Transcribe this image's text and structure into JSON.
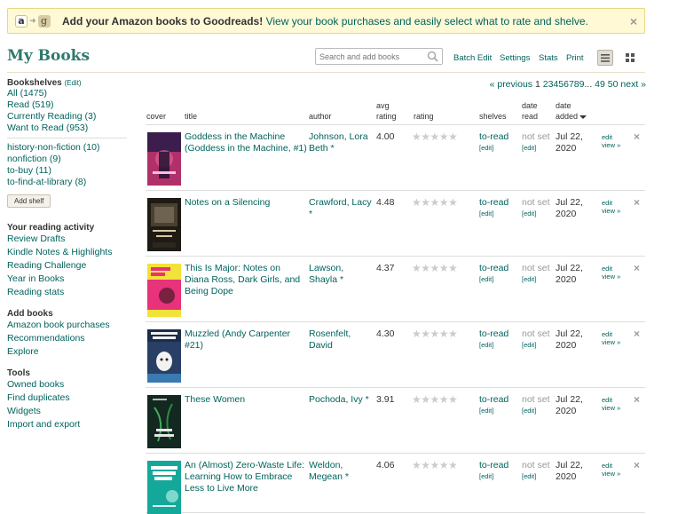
{
  "banner": {
    "bold_text": "Add your Amazon books to Goodreads!",
    "rest_text": " View your book purchases and easily select what to rate and shelve.",
    "logo_a": "a",
    "logo_g": "g",
    "close": "×"
  },
  "header": {
    "title": "My Books",
    "search_placeholder": "Search and add books",
    "links": {
      "batch_edit": "Batch Edit",
      "settings": "Settings",
      "stats": "Stats",
      "print": "Print"
    }
  },
  "sidebar": {
    "bookshelves_heading": "Bookshelves",
    "bookshelves_edit": "(Edit)",
    "shelves": [
      {
        "label": "All (1475)"
      },
      {
        "label": "Read (519)"
      },
      {
        "label": "Currently Reading (3)"
      },
      {
        "label": "Want to Read (953)"
      }
    ],
    "custom_shelves": [
      {
        "label": "history-non-fiction (10)"
      },
      {
        "label": "nonfiction (9)"
      },
      {
        "label": "to-buy (11)"
      },
      {
        "label": "to-find-at-library (8)"
      }
    ],
    "add_shelf": "Add shelf",
    "activity_heading": "Your reading activity",
    "activity": [
      {
        "label": "Review Drafts"
      },
      {
        "label": "Kindle Notes & Highlights"
      },
      {
        "label": "Reading Challenge"
      },
      {
        "label": "Year in Books"
      },
      {
        "label": "Reading stats"
      }
    ],
    "add_books_heading": "Add books",
    "add_books": [
      {
        "label": "Amazon book purchases"
      },
      {
        "label": "Recommendations"
      },
      {
        "label": "Explore"
      }
    ],
    "tools_heading": "Tools",
    "tools": [
      {
        "label": "Owned books"
      },
      {
        "label": "Find duplicates"
      },
      {
        "label": "Widgets"
      },
      {
        "label": "Import and export"
      }
    ]
  },
  "pagination": {
    "previous": "« previous",
    "current": "1",
    "pages": [
      "2",
      "3",
      "4",
      "5",
      "6",
      "7",
      "8",
      "9"
    ],
    "ellipsis": "...",
    "tail": [
      "49",
      "50"
    ],
    "next": "next »"
  },
  "table": {
    "headers": {
      "cover": "cover",
      "title": "title",
      "author": "author",
      "avg_line1": "avg",
      "avg_line2": "rating",
      "rating": "rating",
      "shelves": "shelves",
      "date_read_line1": "date",
      "date_read_line2": "read",
      "date_added_line1": "date",
      "date_added_line2": "added"
    },
    "rows": [
      {
        "title": "Goddess in the Machine (Goddess in the Machine, #1)",
        "author": "Johnson, Lora Beth *",
        "avg": "4.00",
        "stars": "★★★★★",
        "shelf": "to-read",
        "shelf_edit": "[edit]",
        "date_read": "not set",
        "date_read_edit": "[edit]",
        "date_added": "Jul 22, 2020",
        "edit": "edit",
        "view": "view »",
        "remove": "×",
        "cover_color": "#b0306a"
      },
      {
        "title": "Notes on a Silencing",
        "author": "Crawford, Lacy *",
        "avg": "4.48",
        "stars": "★★★★★",
        "shelf": "to-read",
        "shelf_edit": "[edit]",
        "date_read": "not set",
        "date_read_edit": "[edit]",
        "date_added": "Jul 22, 2020",
        "edit": "edit",
        "view": "view »",
        "remove": "×",
        "cover_color": "#1e1a14"
      },
      {
        "title": "This Is Major: Notes on Diana Ross, Dark Girls, and Being Dope",
        "author": "Lawson, Shayla *",
        "avg": "4.37",
        "stars": "★★★★★",
        "shelf": "to-read",
        "shelf_edit": "[edit]",
        "date_read": "not set",
        "date_read_edit": "[edit]",
        "date_added": "Jul 22, 2020",
        "edit": "edit",
        "view": "view »",
        "remove": "×",
        "cover_color": "#e8327a"
      },
      {
        "title": "Muzzled (Andy Carpenter #21)",
        "author": "Rosenfelt, David",
        "avg": "4.30",
        "stars": "★★★★★",
        "shelf": "to-read",
        "shelf_edit": "[edit]",
        "date_read": "not set",
        "date_read_edit": "[edit]",
        "date_added": "Jul 22, 2020",
        "edit": "edit",
        "view": "view »",
        "remove": "×",
        "cover_color": "#2a3f66"
      },
      {
        "title": "These Women",
        "author": "Pochoda, Ivy *",
        "avg": "3.91",
        "stars": "★★★★★",
        "shelf": "to-read",
        "shelf_edit": "[edit]",
        "date_read": "not set",
        "date_read_edit": "[edit]",
        "date_added": "Jul 22, 2020",
        "edit": "edit",
        "view": "view »",
        "remove": "×",
        "cover_color": "#132820"
      },
      {
        "title": "An (Almost) Zero-Waste Life: Learning How to Embrace Less to Live More",
        "author": "Weldon, Megean *",
        "avg": "4.06",
        "stars": "★★★★★",
        "shelf": "to-read",
        "shelf_edit": "[edit]",
        "date_read": "not set",
        "date_read_edit": "[edit]",
        "date_added": "Jul 22, 2020",
        "edit": "edit",
        "view": "view »",
        "remove": "×",
        "cover_color": "#14a89a"
      }
    ]
  }
}
